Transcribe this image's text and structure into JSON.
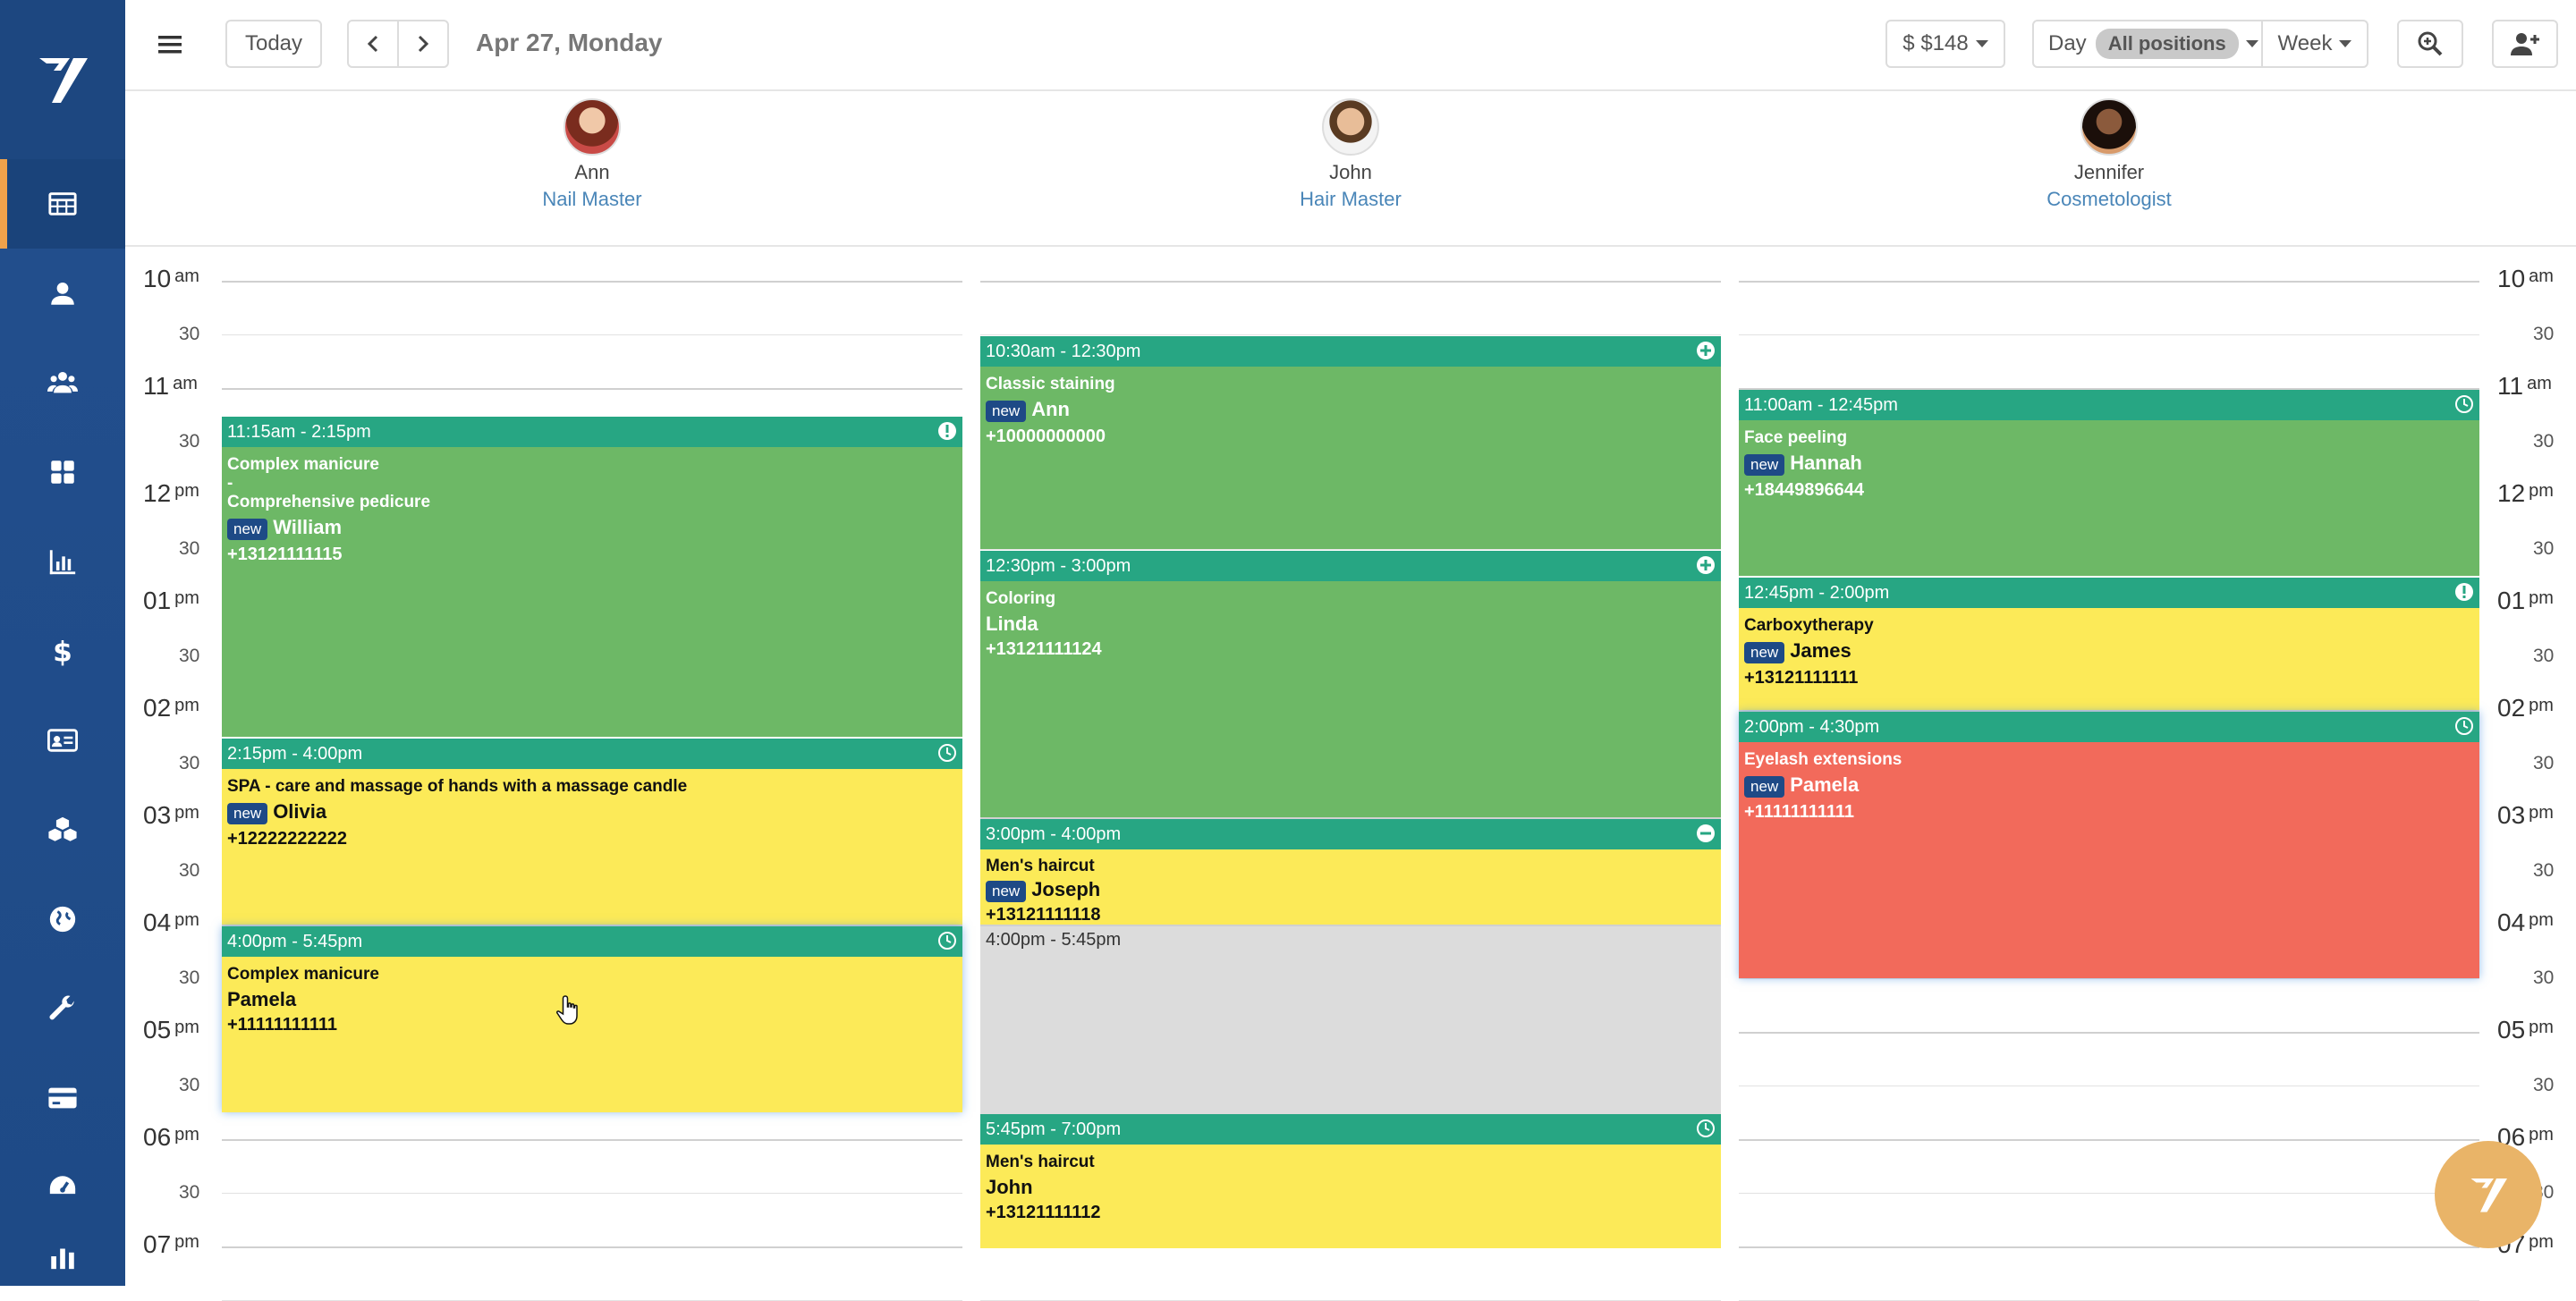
{
  "toolbar": {
    "today_label": "Today",
    "date": "Apr 27, Monday",
    "price_label": "$ $148",
    "day_label": "Day",
    "positions_label": "All positions",
    "week_label": "Week"
  },
  "staff": [
    {
      "name": "Ann",
      "position": "Nail Master"
    },
    {
      "name": "John",
      "position": "Hair Master"
    },
    {
      "name": "Jennifer",
      "position": "Cosmetologist"
    }
  ],
  "times": {
    "h10": "10",
    "h10_ampm": "am",
    "h11": "11",
    "h11_ampm": "am",
    "h12": "12",
    "h12_ampm": "pm",
    "h01": "01",
    "h01_ampm": "pm",
    "h02": "02",
    "h02_ampm": "pm",
    "h03": "03",
    "h03_ampm": "pm",
    "h04": "04",
    "h04_ampm": "pm",
    "h05": "05",
    "h05_ampm": "pm",
    "h06": "06",
    "h06_ampm": "pm",
    "h07": "07",
    "h07_ampm": "pm",
    "half": "30"
  },
  "appointments": {
    "ann1": {
      "time": "11:15am - 2:15pm",
      "service1": "Complex manicure",
      "sep": "-",
      "service2": "Comprehensive pedicure",
      "badge": "new",
      "client": "William",
      "phone": "+13121111115"
    },
    "ann2": {
      "time": "2:15pm - 4:00pm",
      "service": "SPA - care and massage of hands with a massage candle",
      "badge": "new",
      "client": "Olivia",
      "phone": "+12222222222"
    },
    "ann3": {
      "time": "4:00pm - 5:45pm",
      "service": "Complex manicure",
      "client": "Pamela",
      "phone": "+11111111111"
    },
    "john1": {
      "time": "10:30am - 12:30pm",
      "service": "Classic staining",
      "badge": "new",
      "client": "Ann",
      "phone": "+10000000000"
    },
    "john2": {
      "time": "12:30pm - 3:00pm",
      "service": "Coloring",
      "client": "Linda",
      "phone": "+13121111124"
    },
    "john3": {
      "time": "3:00pm - 4:00pm",
      "service": "Men's haircut",
      "badge": "new",
      "client": "Joseph",
      "phone": "+13121111118"
    },
    "john_break": {
      "time": "4:00pm - 5:45pm"
    },
    "john4": {
      "time": "5:45pm - 7:00pm",
      "service": "Men's haircut",
      "client": "John",
      "phone": "+13121111112"
    },
    "jen1": {
      "time": "11:00am - 12:45pm",
      "service": "Face peeling",
      "badge": "new",
      "client": "Hannah",
      "phone": "+18449896644"
    },
    "jen2": {
      "time": "12:45pm - 2:00pm",
      "service": "Carboxytherapy",
      "badge": "new",
      "client": "James",
      "phone": "+13121111111"
    },
    "jen3": {
      "time": "2:00pm - 4:30pm",
      "service": "Eyelash extensions",
      "badge": "new",
      "client": "Pamela",
      "phone": "+11111111111"
    }
  },
  "colors": {
    "sidebar": "#1f4e8c",
    "header_green": "#27a683",
    "block_green": "#6db866",
    "block_yellow": "#fcea58",
    "block_red": "#f26a5b",
    "block_grey": "#dcdcdc",
    "accent_orange": "#f0a24b"
  },
  "icons": {
    "sidebar": [
      "calendar-grid-icon",
      "user-icon",
      "users-icon",
      "apps-icon",
      "bar-chart-icon",
      "dollar-icon",
      "id-card-icon",
      "boxes-icon",
      "globe-icon",
      "wrench-icon",
      "credit-card-icon",
      "dashboard-icon"
    ],
    "status": [
      "exclamation-icon",
      "clock-icon",
      "plus-icon",
      "minus-icon"
    ]
  }
}
